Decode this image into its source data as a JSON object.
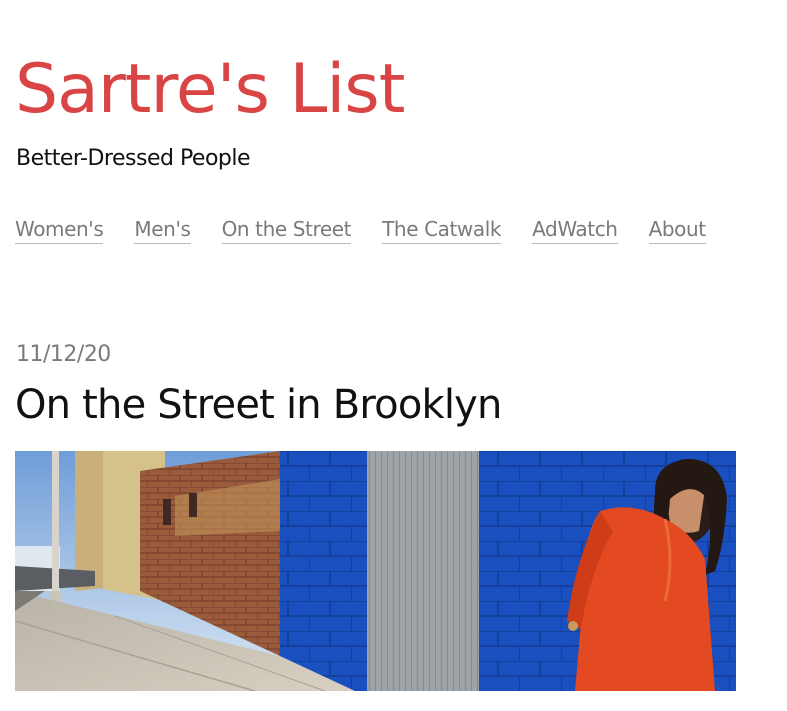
{
  "site": {
    "title": "Sartre's List",
    "tagline": "Better-Dressed People"
  },
  "nav": {
    "items": [
      {
        "label": "Women's"
      },
      {
        "label": "Men's"
      },
      {
        "label": "On the Street"
      },
      {
        "label": "The Catwalk"
      },
      {
        "label": "AdWatch"
      },
      {
        "label": "About"
      }
    ]
  },
  "post": {
    "date": "11/12/20",
    "title": "On the Street in Brooklyn"
  },
  "colors": {
    "brand": "#d94444",
    "nav_text": "#7a7a7a",
    "body_text": "#111111"
  }
}
